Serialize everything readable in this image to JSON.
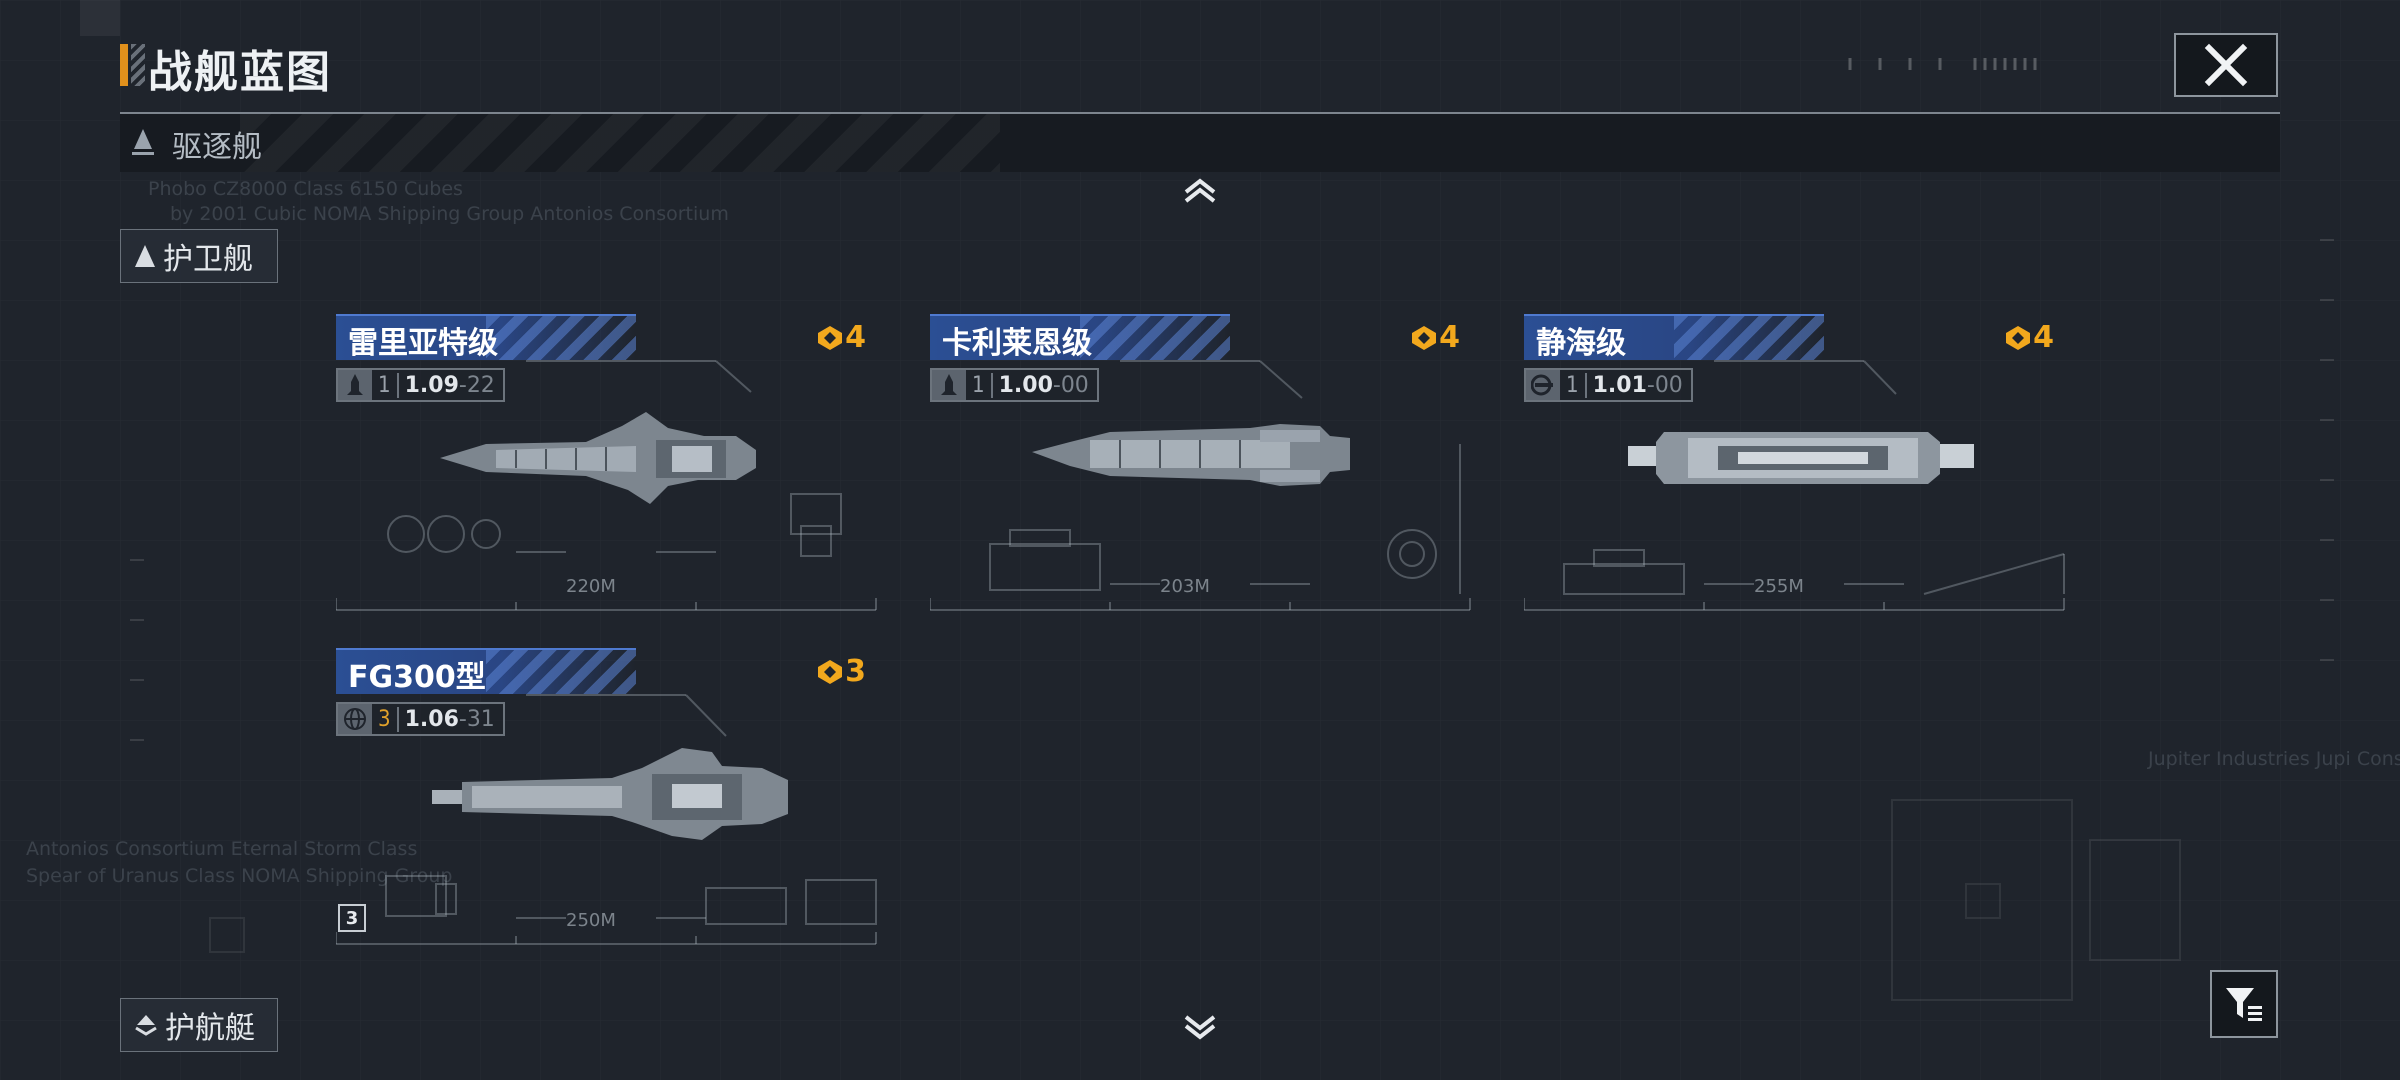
{
  "header": {
    "title": "战舰蓝图"
  },
  "destroyer_bar": {
    "label": "驱逐舰"
  },
  "categories": [
    {
      "label": "护卫舰"
    },
    {
      "label": "护航艇"
    }
  ],
  "ships": [
    {
      "name": "雷里亚特级",
      "tier": "4",
      "level": "1",
      "version": "1.09",
      "version_sub": "-22",
      "length": "220M",
      "type_icon": "rocket-icon"
    },
    {
      "name": "卡利莱恩级",
      "tier": "4",
      "level": "1",
      "version": "1.00",
      "version_sub": "-00",
      "length": "203M",
      "type_icon": "rocket-icon"
    },
    {
      "name": "静海级",
      "tier": "4",
      "level": "1",
      "version": "1.01",
      "version_sub": "-00",
      "length": "255M",
      "type_icon": "radar-icon"
    },
    {
      "name": "FG300型",
      "tier": "3",
      "level": "3",
      "version": "1.06",
      "version_sub": "-31",
      "length": "250M",
      "type_icon": "globe-icon"
    }
  ],
  "card_badge": "3",
  "background_text": {
    "l1": "Phobo CZ8000 Class 6150 Cubes",
    "l2": "by 2001 Cubic NOMA Shipping Group Antonios Consortium",
    "l3": "Antonios Consortium Eternal Storm Class",
    "l4": "Spear of Uranus Class NOMA Shipping Group",
    "l5": "Jupiter Industries   Jupi Consort"
  },
  "colors": {
    "accent": "#e0901c",
    "tier": "#f2a81d",
    "name_tab": "#2b4f94"
  }
}
